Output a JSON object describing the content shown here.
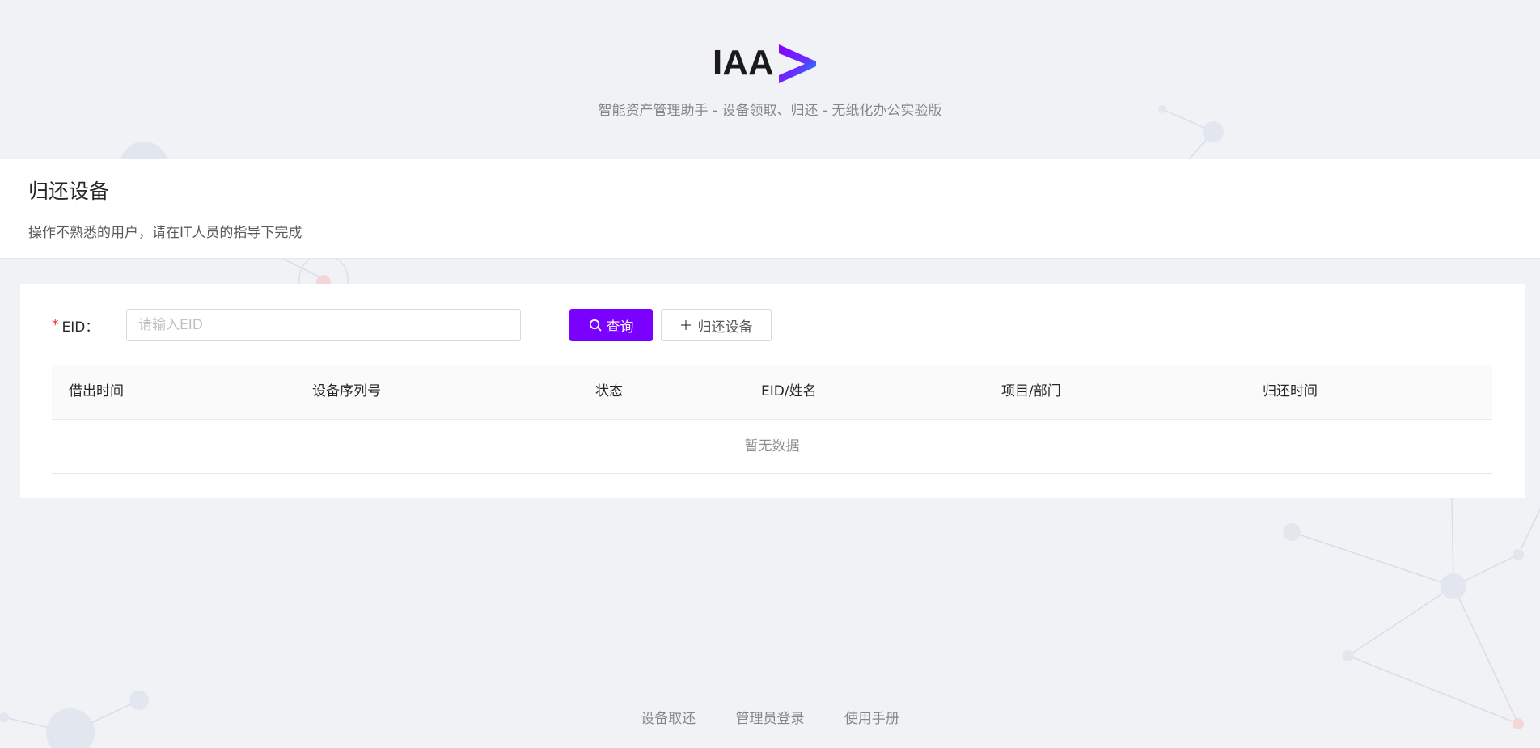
{
  "header": {
    "logo_text": "IAA",
    "subtitle": "智能资产管理助手 - 设备领取、归还 - 无纸化办公实验版"
  },
  "page_header": {
    "title": "归还设备",
    "description": "操作不熟悉的用户，请在IT人员的指导下完成"
  },
  "form": {
    "eid_label": "EID：",
    "required_mark": "*",
    "eid_placeholder": "请输入EID",
    "eid_value": "",
    "query_button": "查询",
    "return_button": "归还设备"
  },
  "table": {
    "columns": [
      "借出时间",
      "设备序列号",
      "状态",
      "EID/姓名",
      "项目/部门",
      "归还时间"
    ],
    "empty_text": "暂无数据"
  },
  "footer": {
    "links": [
      "设备取还",
      "管理员登录",
      "使用手册"
    ]
  },
  "colors": {
    "primary": "#7a00ff",
    "background": "#f0f2f5",
    "required": "#f5222d"
  },
  "icons": {
    "query": "search-icon",
    "return": "plus-icon",
    "logo": "chevron-right-logo-icon"
  }
}
